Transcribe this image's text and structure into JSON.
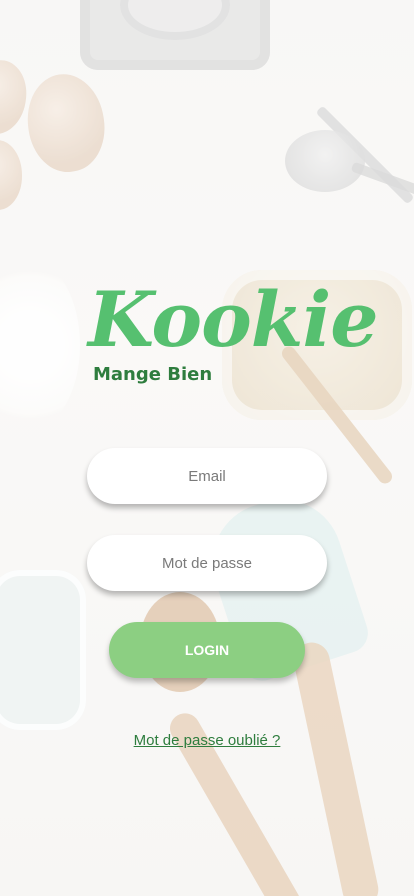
{
  "brand": {
    "logo_text": "Kookie",
    "tagline": "Mange Bien",
    "logo_color": "#56c070",
    "tagline_color": "#2e7d3e"
  },
  "form": {
    "email_placeholder": "Email",
    "password_placeholder": "Mot de passe",
    "login_label": "LOGIN",
    "login_color": "#8ccf82",
    "forgot_password_link": "Mot de passe oublié ?"
  }
}
